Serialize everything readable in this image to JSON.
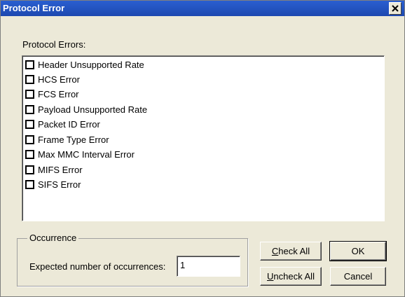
{
  "window": {
    "title": "Protocol Error"
  },
  "errors_group": {
    "label": "Protocol Errors:"
  },
  "errors": [
    {
      "label": "Header Unsupported Rate",
      "checked": false
    },
    {
      "label": "HCS Error",
      "checked": false
    },
    {
      "label": "FCS Error",
      "checked": false
    },
    {
      "label": "Payload Unsupported Rate",
      "checked": false
    },
    {
      "label": "Packet ID Error",
      "checked": false
    },
    {
      "label": "Frame Type Error",
      "checked": false
    },
    {
      "label": "Max MMC Interval Error",
      "checked": false
    },
    {
      "label": "MIFS Error",
      "checked": false
    },
    {
      "label": "SIFS Error",
      "checked": false
    }
  ],
  "occurrence": {
    "legend": "Occurrence",
    "label": "Expected number of occurrences:",
    "value": "1"
  },
  "buttons": {
    "check_all_underline": "C",
    "check_all_rest": "heck All",
    "uncheck_all_underline": "U",
    "uncheck_all_rest": "ncheck All",
    "ok": "OK",
    "cancel": "Cancel"
  },
  "colors": {
    "titlebar": "#2a5fd0",
    "dialog_bg": "#ece9d8"
  }
}
